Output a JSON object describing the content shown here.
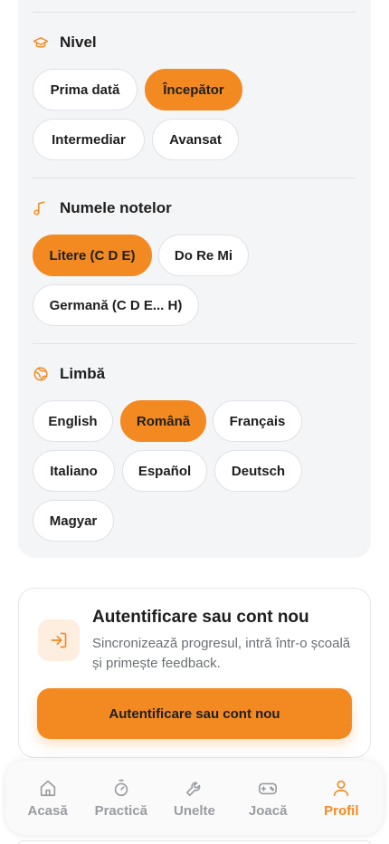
{
  "settings": {
    "level": {
      "title": "Nivel",
      "icon": "graduation-cap-icon",
      "options": [
        "Prima dată",
        "Începător",
        "Intermediar",
        "Avansat"
      ],
      "selected": "Începător"
    },
    "note_names": {
      "title": "Numele notelor",
      "icon": "music-note-icon",
      "options": [
        "Litere (C D E)",
        "Do Re Mi",
        "Germană (C D E... H)"
      ],
      "selected": "Litere (C D E)"
    },
    "language": {
      "title": "Limbă",
      "icon": "globe-icon",
      "options": [
        "English",
        "Română",
        "Français",
        "Italiano",
        "Español",
        "Deutsch",
        "Magyar"
      ],
      "selected": "Română"
    }
  },
  "auth": {
    "icon": "sign-in-icon",
    "title": "Autentificare sau cont nou",
    "subtitle": "Sincronizează progresul, intră într-o școală și primește feedback.",
    "button_label": "Autentificare sau cont nou"
  },
  "tab_bar": {
    "items": [
      {
        "label": "Acasă",
        "icon": "home-icon"
      },
      {
        "label": "Practică",
        "icon": "stopwatch-icon"
      },
      {
        "label": "Unelte",
        "icon": "wrench-icon"
      },
      {
        "label": "Joacă",
        "icon": "gamepad-icon"
      },
      {
        "label": "Profil",
        "icon": "user-icon"
      }
    ],
    "active": "Profil"
  },
  "colors": {
    "accent": "#f28a21",
    "card_bg": "#f4f5f7",
    "inactive_tab": "#9a9ca1"
  }
}
